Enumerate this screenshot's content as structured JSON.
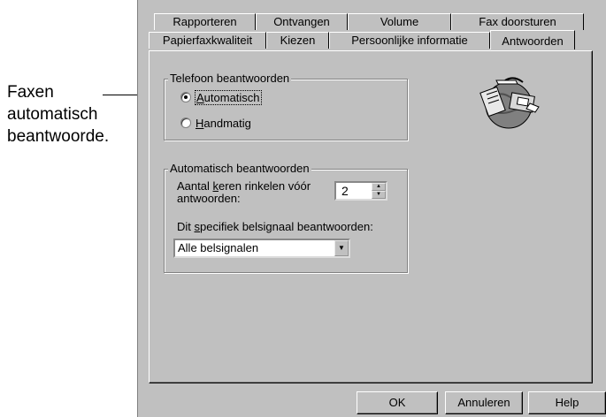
{
  "callout": {
    "line1": "Faxen",
    "line2": "automatisch",
    "line3": "beantwoorde."
  },
  "tabs_back": [
    "Rapporteren",
    "Ontvangen",
    "Volume",
    "Fax doorsturen"
  ],
  "tabs_front": [
    "Papierfaxkwaliteit",
    "Kiezen",
    "Persoonlijke informatie",
    "Antwoorden"
  ],
  "active_tab": "Antwoorden",
  "group_answer": {
    "title": "Telefoon beantwoorden",
    "option_auto_u": "A",
    "option_auto_rest": "utomatisch",
    "option_manual_u": "H",
    "option_manual_rest": "andmatig",
    "selected": "Automatisch"
  },
  "group_auto": {
    "title": "Automatisch beantwoorden",
    "rings_label_pre": "Aantal ",
    "rings_label_u": "k",
    "rings_label_post": "eren rinkelen vóór",
    "rings_label_line2": "antwoorden:",
    "rings_value": "2",
    "ring_label_pre": "Dit ",
    "ring_label_u": "s",
    "ring_label_post": "pecifiek belsignaal beantwoorden:",
    "ring_select_value": "Alle belsignalen"
  },
  "buttons": {
    "ok": "OK",
    "cancel": "Annuleren",
    "help": "Help"
  },
  "icons": {
    "fax_globe": "fax-globe-icon"
  }
}
